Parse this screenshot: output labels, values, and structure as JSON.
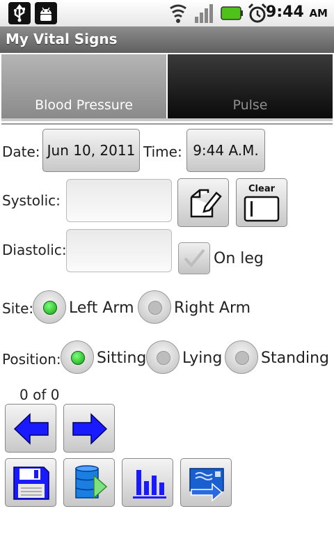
{
  "status_bar": {
    "time": "9:44",
    "ampm": "AM",
    "icons": [
      "usb-icon",
      "android-debug-icon",
      "wifi-icon",
      "signal-icon",
      "battery-icon",
      "alarm-icon"
    ]
  },
  "app": {
    "title": "My Vital Signs"
  },
  "tabs": [
    {
      "label": "Blood Pressure",
      "selected": true
    },
    {
      "label": "Pulse",
      "selected": false
    }
  ],
  "form": {
    "date_label": "Date:",
    "date_value": "Jun 10, 2011",
    "time_label": "Time:",
    "time_value": "9:44 A.M.",
    "systolic_label": "Systolic:",
    "systolic_value": "",
    "diastolic_label": "Diastolic:",
    "diastolic_value": "",
    "clear_label": "Clear",
    "on_leg_label": "On leg",
    "on_leg_checked": false,
    "site_label": "Site:",
    "site_options": [
      "Left Arm",
      "Right Arm"
    ],
    "site_selected": "Left Arm",
    "position_label": "Position:",
    "position_options": [
      "Sitting",
      "Lying",
      "Standing"
    ],
    "position_selected": "Sitting"
  },
  "navigation": {
    "record_counter": "0 of 0"
  },
  "toolbar": {
    "icons": [
      "save-icon",
      "database-export-icon",
      "bar-chart-icon",
      "send-icon"
    ]
  },
  "colors": {
    "arrow_blue": "#1a1aff",
    "radio_on": "#12a012"
  }
}
